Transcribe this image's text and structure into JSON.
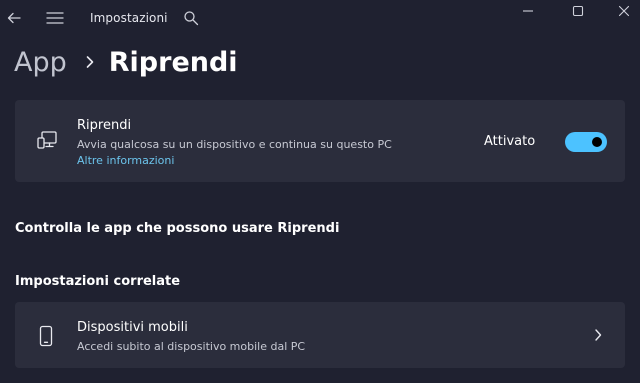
{
  "window": {
    "app_title": "Impostazioni",
    "icons": {
      "back": "back-arrow-icon",
      "menu": "hamburger-menu-icon",
      "search": "search-icon",
      "minimize": "minimize-icon",
      "maximize": "maximize-icon",
      "close": "close-icon"
    }
  },
  "breadcrumb": {
    "parent": "App",
    "current": "Riprendi"
  },
  "resume_card": {
    "title": "Riprendi",
    "description": "Avvia qualcosa su un dispositivo e continua su questo PC",
    "link": "Altre informazioni",
    "toggle_label": "Attivato",
    "toggle_on": true,
    "icon": "devices-icon"
  },
  "sections": {
    "apps_heading": "Controlla le app che possono usare Riprendi",
    "related_heading": "Impostazioni correlate"
  },
  "mobile_card": {
    "title": "Dispositivi mobili",
    "description": "Accedi subito al dispositivo mobile dal PC",
    "icon": "phone-icon"
  },
  "colors": {
    "background": "#1f2130",
    "card": "#2b2d3c",
    "accent": "#4cc2ff",
    "link": "#6cc4ec"
  }
}
